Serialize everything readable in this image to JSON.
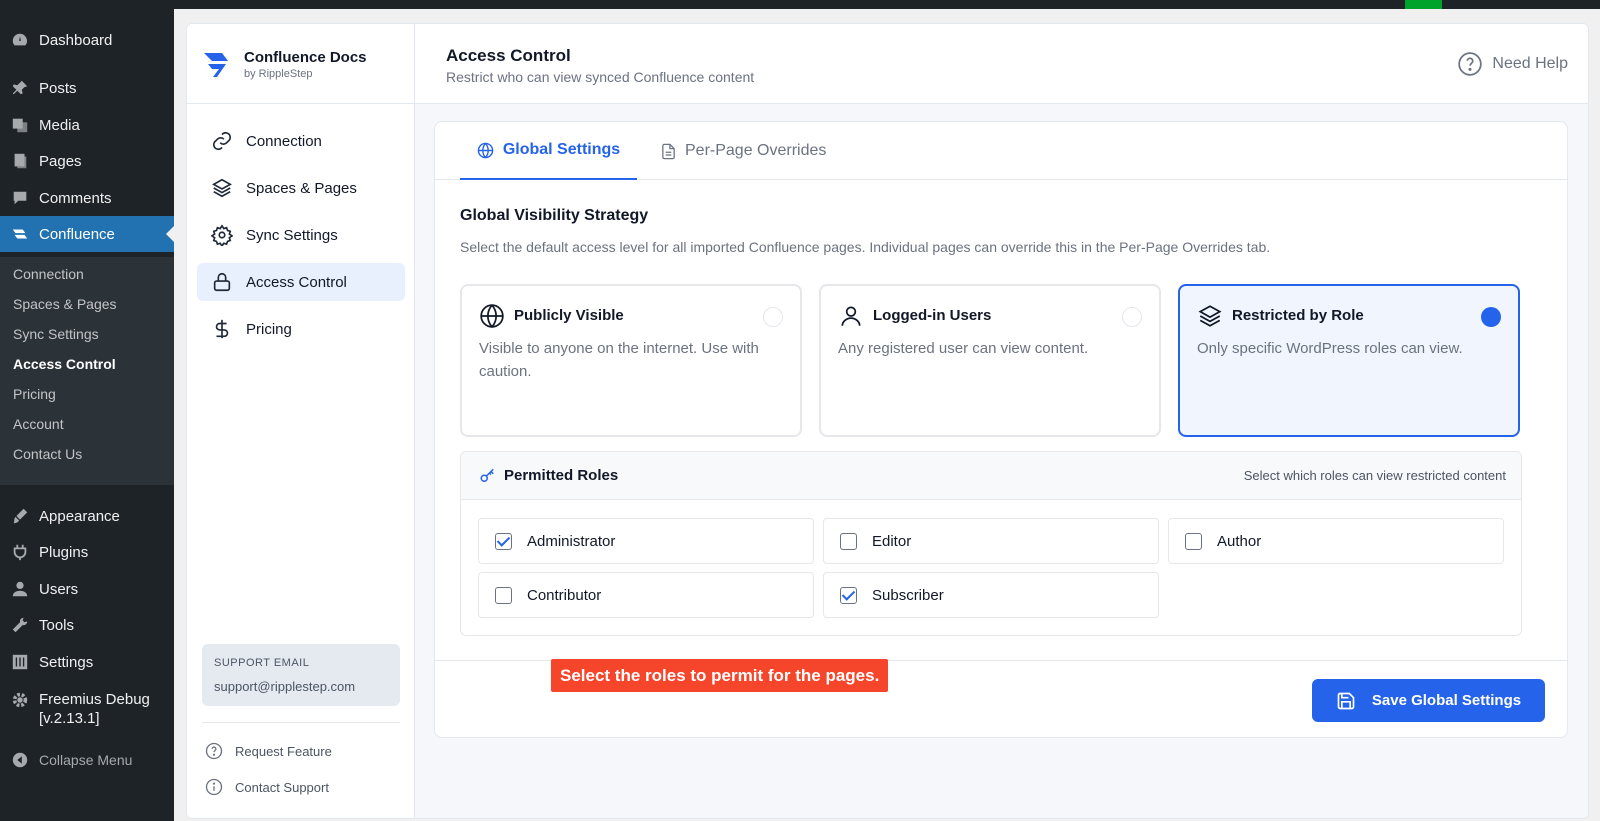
{
  "wp_menu": {
    "items": [
      {
        "label": "Dashboard",
        "icon": "dashboard-icon"
      },
      {
        "label": "Posts",
        "icon": "pin-icon"
      },
      {
        "label": "Media",
        "icon": "media-icon"
      },
      {
        "label": "Pages",
        "icon": "pages-icon"
      },
      {
        "label": "Comments",
        "icon": "comment-icon"
      },
      {
        "label": "Confluence",
        "icon": "confluence-icon"
      },
      {
        "label": "Appearance",
        "icon": "brush-icon"
      },
      {
        "label": "Plugins",
        "icon": "plugin-icon"
      },
      {
        "label": "Users",
        "icon": "user-icon"
      },
      {
        "label": "Tools",
        "icon": "wrench-icon"
      },
      {
        "label": "Settings",
        "icon": "settings-icon"
      },
      {
        "label": "Freemius Debug [v.2.13.1]",
        "icon": "gear-icon"
      },
      {
        "label": "Collapse Menu",
        "icon": "collapse-icon"
      }
    ],
    "submenu": [
      "Connection",
      "Spaces & Pages",
      "Sync Settings",
      "Access Control",
      "Pricing",
      "Account",
      "Contact Us"
    ]
  },
  "brand": {
    "name": "Confluence Docs",
    "by": "by RippleStep"
  },
  "nav": [
    {
      "label": "Connection",
      "icon": "link-icon"
    },
    {
      "label": "Spaces & Pages",
      "icon": "layers-icon"
    },
    {
      "label": "Sync Settings",
      "icon": "gear-icon"
    },
    {
      "label": "Access Control",
      "icon": "lock-icon"
    },
    {
      "label": "Pricing",
      "icon": "dollar-icon"
    }
  ],
  "support": {
    "label": "SUPPORT EMAIL",
    "email": "support@ripplestep.com"
  },
  "side_links": [
    {
      "label": "Request Feature",
      "icon": "question-icon"
    },
    {
      "label": "Contact Support",
      "icon": "info-icon"
    }
  ],
  "header": {
    "title": "Access Control",
    "subtitle": "Restrict who can view synced Confluence content",
    "help": "Need Help"
  },
  "tabs": [
    {
      "label": "Global Settings",
      "icon": "globe-icon",
      "active": true
    },
    {
      "label": "Per-Page Overrides",
      "icon": "document-icon",
      "active": false
    }
  ],
  "strategy": {
    "title": "Global Visibility Strategy",
    "description": "Select the default access level for all imported Confluence pages. Individual pages can override this in the Per-Page Overrides tab.",
    "options": [
      {
        "title": "Publicly Visible",
        "description": "Visible to anyone on the internet. Use with caution.",
        "icon": "globe-icon",
        "selected": false
      },
      {
        "title": "Logged-in Users",
        "description": "Any registered user can view content.",
        "icon": "user-icon",
        "selected": false
      },
      {
        "title": "Restricted by Role",
        "description": "Only specific WordPress roles can view.",
        "icon": "layers-icon",
        "selected": true
      }
    ]
  },
  "roles": {
    "title": "Permitted Roles",
    "hint": "Select which roles can view restricted content",
    "items": [
      {
        "label": "Administrator",
        "checked": true
      },
      {
        "label": "Editor",
        "checked": false
      },
      {
        "label": "Author",
        "checked": false
      },
      {
        "label": "Contributor",
        "checked": false
      },
      {
        "label": "Subscriber",
        "checked": true
      }
    ]
  },
  "save_label": "Save Global Settings",
  "tooltip": "Select the roles to permit for the pages.",
  "colors": {
    "accent": "#2563eb",
    "wp_active": "#2271b1",
    "tooltip": "#f5452b"
  }
}
